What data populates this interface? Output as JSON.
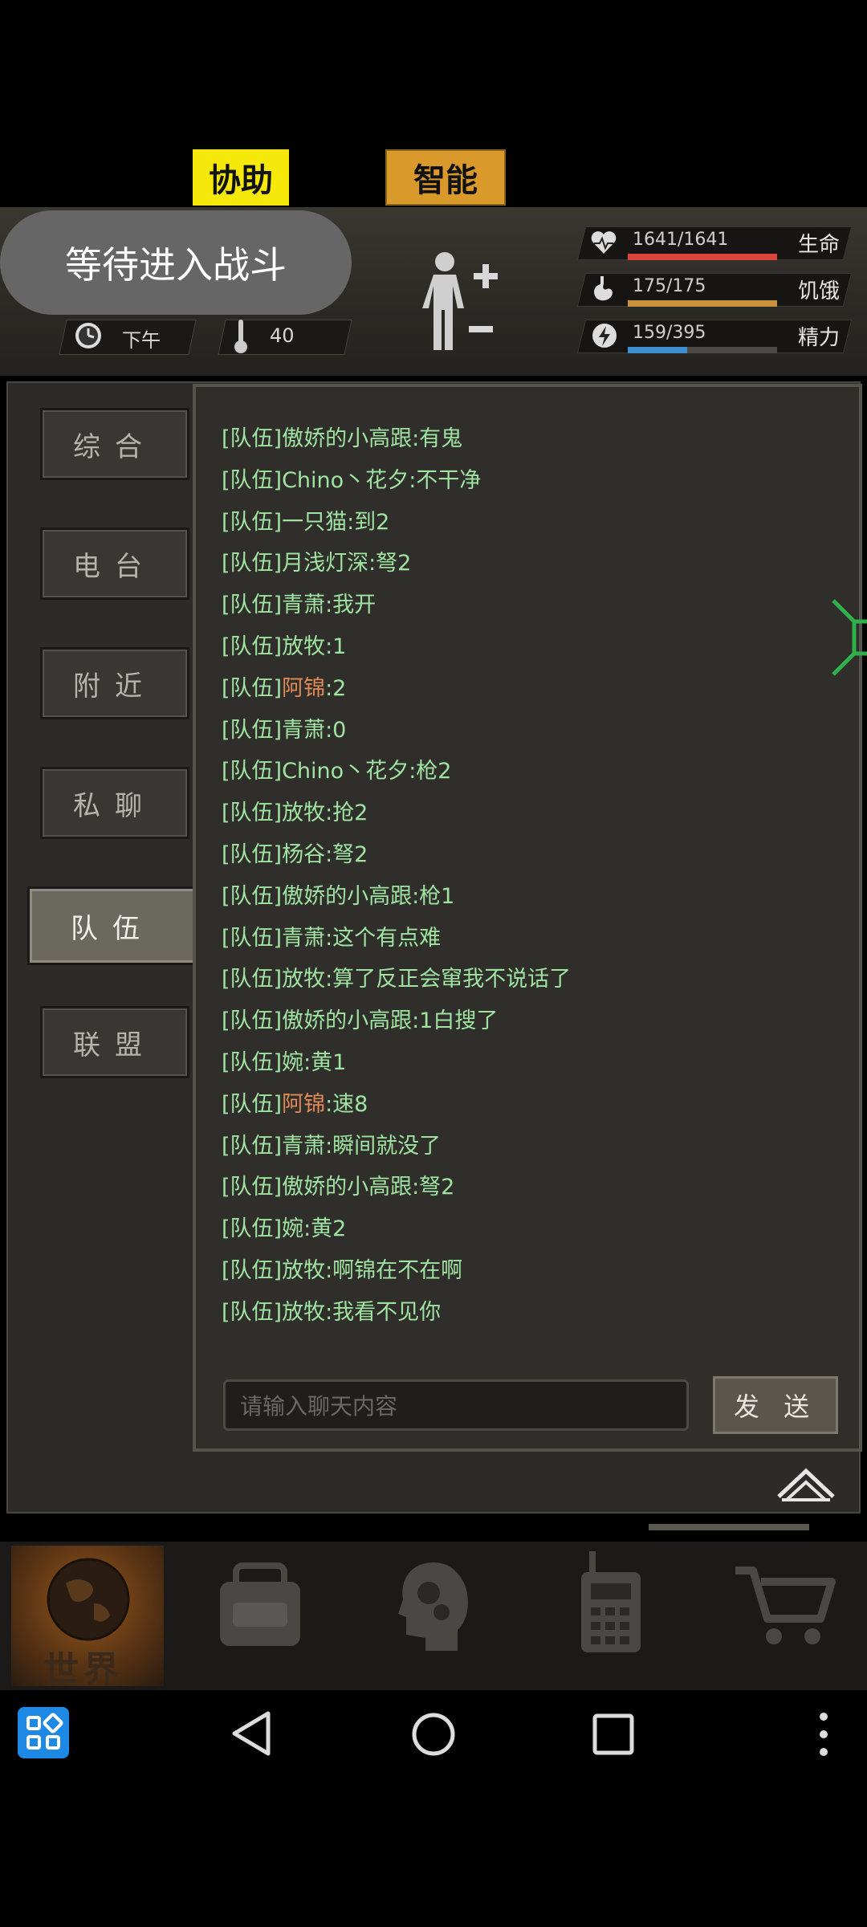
{
  "top_buttons": {
    "assist": "协助",
    "smart": "智能"
  },
  "status": {
    "pill": "等待进入战斗",
    "time": "下午",
    "temperature": "40"
  },
  "stats": [
    {
      "label": "生命",
      "value": "1641/1641",
      "fraction": 1.0,
      "color": "#d9453a",
      "icon": "heart-icon"
    },
    {
      "label": "饥饿",
      "value": "175/175",
      "fraction": 1.0,
      "color": "#c9913b",
      "icon": "stomach-icon"
    },
    {
      "label": "精力",
      "value": "159/395",
      "fraction": 0.4,
      "color": "#3f8fd0",
      "icon": "energy-icon"
    }
  ],
  "tabs": [
    "综合",
    "电台",
    "附近",
    "私聊",
    "队伍",
    "联盟"
  ],
  "active_tab": "队伍",
  "chat": {
    "channel": "[队伍]",
    "messages": [
      {
        "name": "傲娇的小高跟",
        "text": ":有鬼",
        "highlight": false
      },
      {
        "name": "Chino丶花夕",
        "text": ":不干净",
        "highlight": false
      },
      {
        "name": "一只猫",
        "text": ":到2",
        "highlight": false
      },
      {
        "name": "月浅灯深",
        "text": ":弩2",
        "highlight": false
      },
      {
        "name": "青萧",
        "text": ":我开",
        "highlight": false
      },
      {
        "name": "放牧",
        "text": ":1",
        "highlight": false
      },
      {
        "name": "阿锦",
        "text": ":2",
        "highlight": true
      },
      {
        "name": "青萧",
        "text": ":0",
        "highlight": false
      },
      {
        "name": "Chino丶花夕",
        "text": ":枪2",
        "highlight": false
      },
      {
        "name": "放牧",
        "text": ":抢2",
        "highlight": false
      },
      {
        "name": "杨谷",
        "text": ":弩2",
        "highlight": false
      },
      {
        "name": "傲娇的小高跟",
        "text": ":枪1",
        "highlight": false
      },
      {
        "name": "青萧",
        "text": ":这个有点难",
        "highlight": false
      },
      {
        "name": "放牧",
        "text": ":算了反正会窜我不说话了",
        "highlight": false
      },
      {
        "name": "傲娇的小高跟",
        "text": ":1白搜了",
        "highlight": false
      },
      {
        "name": "婉",
        "text": ":黄1",
        "highlight": false
      },
      {
        "name": "阿锦",
        "text": ":速8",
        "highlight": true
      },
      {
        "name": "青萧",
        "text": ":瞬间就没了",
        "highlight": false
      },
      {
        "name": "傲娇的小高跟",
        "text": ":弩2",
        "highlight": false
      },
      {
        "name": "婉",
        "text": ":黄2",
        "highlight": false
      },
      {
        "name": "放牧",
        "text": ":啊锦在不在啊",
        "highlight": false
      },
      {
        "name": "放牧",
        "text": ":我看不见你",
        "highlight": false
      }
    ],
    "input_placeholder": "请输入聊天内容",
    "send_label": "发 送"
  },
  "bottom_nav": {
    "world_label": "世界"
  },
  "colors": {
    "chat_text": "#9fe3a1",
    "highlight_name": "#e08a57",
    "assist_bg": "#f5e80a",
    "smart_bg": "#d99a2b"
  }
}
